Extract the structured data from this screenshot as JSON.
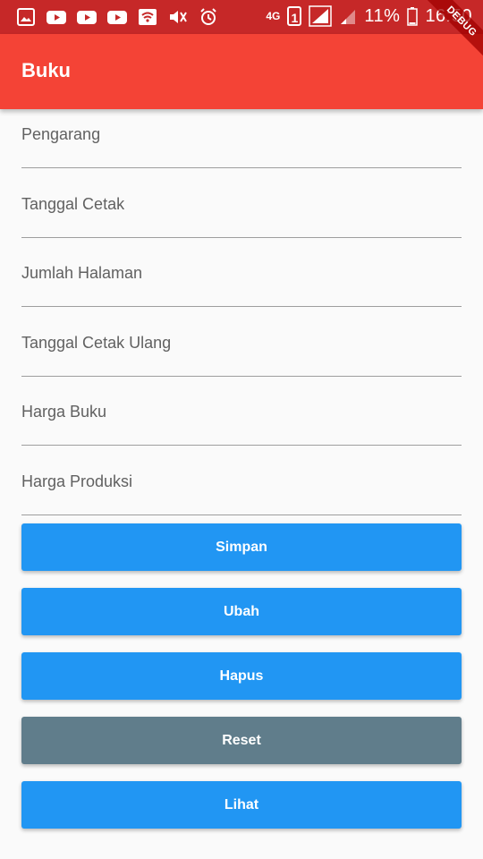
{
  "status_bar": {
    "network_label": "4G",
    "sim_slot": "1",
    "battery_percent": "11%",
    "time": "16:50",
    "icons": [
      "gallery-icon",
      "youtube-icon",
      "youtube-icon",
      "youtube-icon",
      "wifi-icon",
      "mute-vibrate-icon",
      "alarm-icon",
      "signal-icon",
      "battery-icon"
    ]
  },
  "debug_banner": "DEBUG",
  "app_bar": {
    "title": "Buku"
  },
  "form": {
    "fields": [
      {
        "label": "Pengarang"
      },
      {
        "label": "Tanggal Cetak"
      },
      {
        "label": "Jumlah Halaman"
      },
      {
        "label": "Tanggal Cetak Ulang"
      },
      {
        "label": "Harga Buku"
      },
      {
        "label": "Harga Produksi"
      }
    ]
  },
  "buttons": {
    "save": "Simpan",
    "edit": "Ubah",
    "delete": "Hapus",
    "reset": "Reset",
    "view": "Lihat"
  },
  "colors": {
    "status_bar": "#C62828",
    "app_bar": "#F44336",
    "primary_button": "#2196F3",
    "reset_button": "#607D8B",
    "background": "#FAFAFA"
  }
}
